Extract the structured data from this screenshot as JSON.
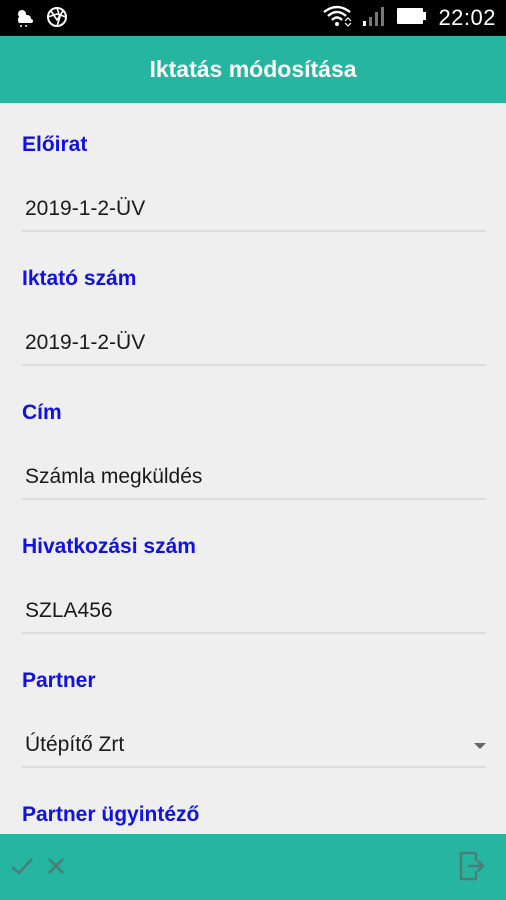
{
  "status_bar": {
    "time": "22:02",
    "icons": [
      "weather-icon",
      "aperture-icon",
      "wifi-icon",
      "signal-icon",
      "battery-icon"
    ]
  },
  "app_bar": {
    "title": "Iktatás módosítása"
  },
  "form": {
    "fields": [
      {
        "label": "Előirat",
        "value": "2019-1-2-ÜV"
      },
      {
        "label": "Iktató szám",
        "value": "2019-1-2-ÜV"
      },
      {
        "label": "Cím",
        "value": "Számla megküldés"
      },
      {
        "label": "Hivatkozási szám",
        "value": "SZLA456"
      },
      {
        "label": "Partner",
        "value": "Útépítő Zrt"
      },
      {
        "label": "Partner ügyintéző",
        "value": ""
      }
    ]
  },
  "bottom_bar": {
    "icons": [
      "check-icon",
      "close-icon",
      "exit-icon"
    ]
  },
  "colors": {
    "accent": "#26b5a1",
    "label": "#1010e8",
    "background": "#efefef"
  }
}
